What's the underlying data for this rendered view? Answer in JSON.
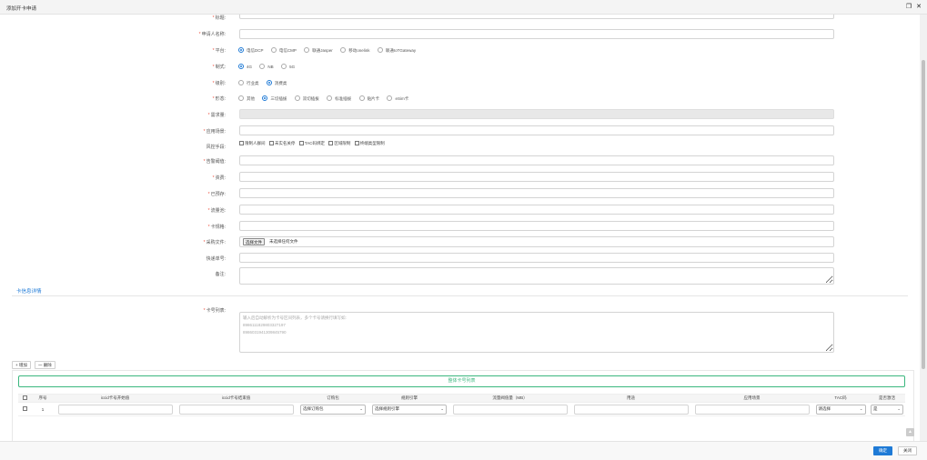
{
  "dialog": {
    "title": "添加开卡申请",
    "restore_icon": "restore-icon",
    "close_icon": "close-icon"
  },
  "form": {
    "title_label": "标题:",
    "applicant_label": "申请人名称:",
    "platform_label": "平台:",
    "platform_options": [
      "电信DCP",
      "电信CMP",
      "联通Jasper",
      "移动onelink",
      "联通IoTGateway"
    ],
    "platform_selected": 0,
    "standard_label": "制式:",
    "standard_options": [
      "4G",
      "NB",
      "5G"
    ],
    "standard_selected": 0,
    "level_label": "级别:",
    "level_options": [
      "行业类",
      "消费类"
    ],
    "level_selected": 1,
    "form_label": "形态:",
    "form_options": [
      "其他",
      "三切插拔",
      "双切插拔",
      "标准插拔",
      "贴片卡",
      "eSim卡"
    ],
    "form_selected": 1,
    "demand_label": "需求量:",
    "application_label": "应用场景:",
    "risk_label": "风控手段:",
    "risk_options": [
      "限制人群间",
      "未实名关停",
      "TAC码绑定",
      "区域限制",
      "终端类型限制"
    ],
    "alert_label": "告警阈值:",
    "fee_label": "资费:",
    "prepaid_label": "已预存:",
    "pool_label": "流量池:",
    "cardtype_label": "卡规格:",
    "purchase_file_label": "采购文件:",
    "file_button": "选择文件",
    "file_status": "未选择任何文件",
    "express_label": "快递单号:",
    "remark_label": "备注:"
  },
  "card_section": {
    "title": "卡信息详情",
    "card_list_label": "卡号列表:",
    "card_list_placeholder": "输入后自动解析为卡号区间列表，多个卡号请换行填写如:\n8986111829803327197\n8986031941309845790"
  },
  "toolbar": {
    "add_label": "+ 增加",
    "delete_label": "一 删除"
  },
  "card_table": {
    "add_list_button": "整体卡号列表",
    "columns": [
      "序号",
      "iccid卡号开始值",
      "iccid卡号结束值",
      "订购包",
      "规则引擎",
      "流量阀值量（MB）",
      "用途",
      "应用场景",
      "TAC码",
      "是否激活"
    ],
    "rows": [
      {
        "index": "1",
        "package_select": "选择订购包",
        "rule_select": "选择规则引擎",
        "tac_select": "请选择",
        "activate_select": "是"
      }
    ]
  },
  "footer": {
    "ok_label": "确定",
    "close_label": "关闭"
  }
}
